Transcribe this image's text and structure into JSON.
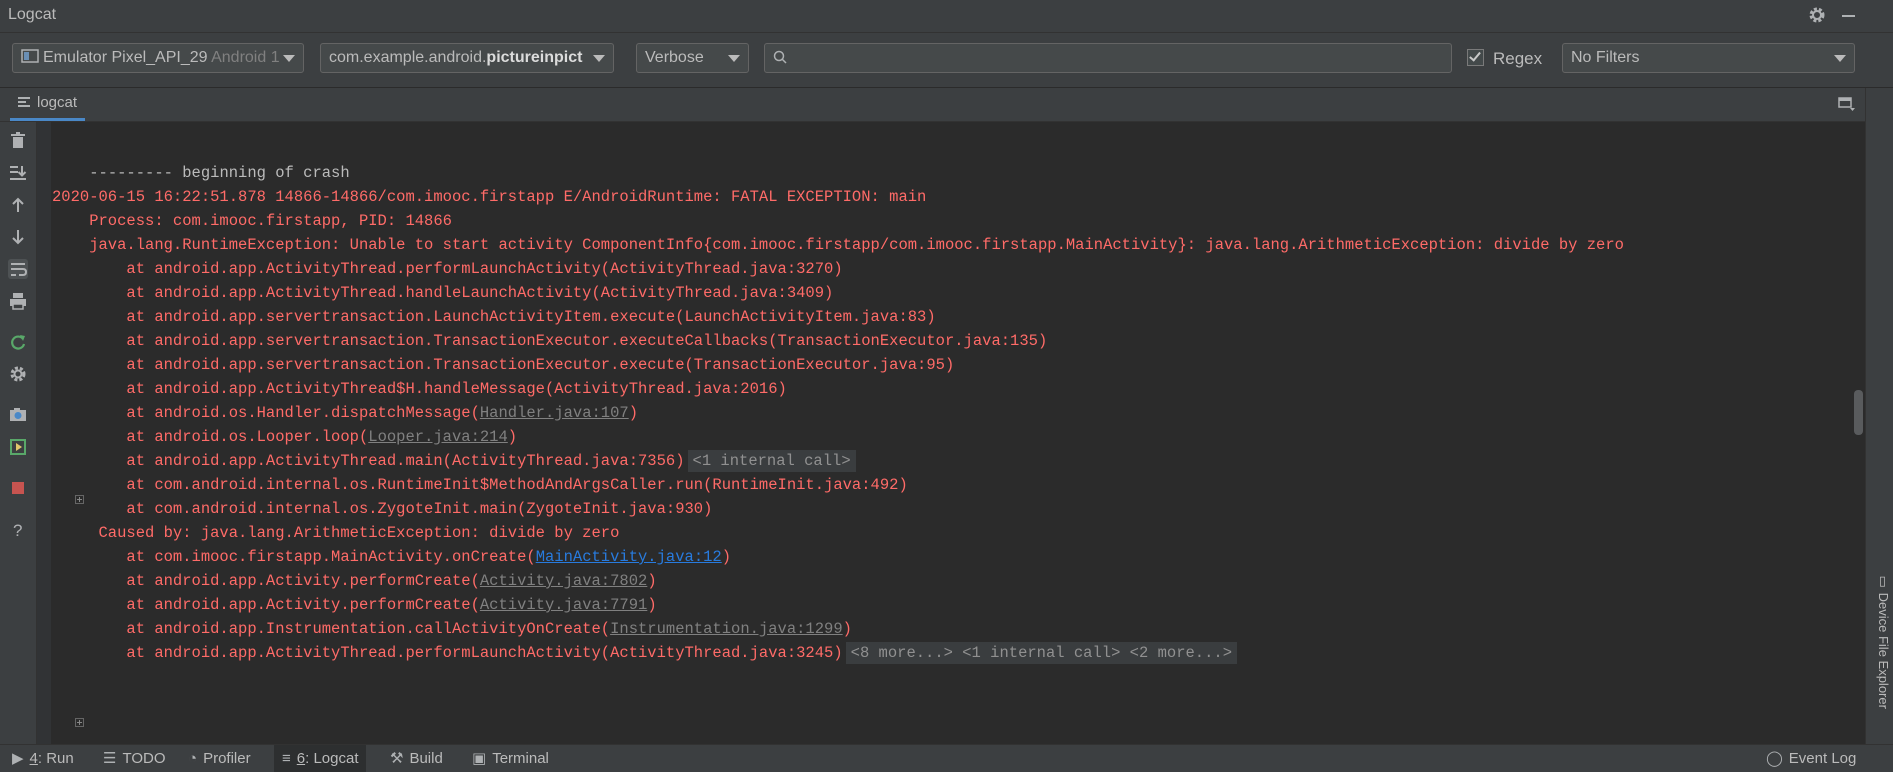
{
  "window": {
    "title": "Logcat"
  },
  "toolbar": {
    "device": {
      "name": "Emulator Pixel_API_29",
      "suffix": "Android 1"
    },
    "process": {
      "prefix": "com.example.android.",
      "bold": "pictureinpict"
    },
    "level": "Verbose",
    "search": {
      "value": "",
      "placeholder": ""
    },
    "regex": {
      "label": "Regex",
      "checked": true
    },
    "filter": "No Filters"
  },
  "tab": {
    "label": "logcat"
  },
  "log": {
    "l0": "--------- beginning of crash",
    "l1": "2020-06-15 16:22:51.878 14866-14866/com.imooc.firstapp E/AndroidRuntime: FATAL EXCEPTION: main",
    "l2": "    Process: com.imooc.firstapp, PID: 14866",
    "l3": "    java.lang.RuntimeException: Unable to start activity ComponentInfo{com.imooc.firstapp/com.imooc.firstapp.MainActivity}: java.lang.ArithmeticException: divide by zero",
    "l4": "        at android.app.ActivityThread.performLaunchActivity(ActivityThread.java:3270)",
    "l5": "        at android.app.ActivityThread.handleLaunchActivity(ActivityThread.java:3409)",
    "l6": "        at android.app.servertransaction.LaunchActivityItem.execute(LaunchActivityItem.java:83)",
    "l7": "        at android.app.servertransaction.TransactionExecutor.executeCallbacks(TransactionExecutor.java:135)",
    "l8": "        at android.app.servertransaction.TransactionExecutor.execute(TransactionExecutor.java:95)",
    "l9": "        at android.app.ActivityThread$H.handleMessage(ActivityThread.java:2016)",
    "l10": {
      "pre": "        at android.os.Handler.dispatchMessage(",
      "link": "Handler.java:107",
      "post": ")"
    },
    "l11": {
      "pre": "        at android.os.Looper.loop(",
      "link": "Looper.java:214",
      "post": ")"
    },
    "l12": {
      "pre": "        at android.app.ActivityThread.main(ActivityThread.java:7356)",
      "tag": "<1 internal call>"
    },
    "l13": "        at com.android.internal.os.RuntimeInit$MethodAndArgsCaller.run(RuntimeInit.java:492)",
    "l14": "        at com.android.internal.os.ZygoteInit.main(ZygoteInit.java:930)",
    "l15": "     Caused by: java.lang.ArithmeticException: divide by zero",
    "l16": {
      "pre": "        at com.imooc.firstapp.MainActivity.onCreate(",
      "link": "MainActivity.java:12",
      "post": ")"
    },
    "l17": {
      "pre": "        at android.app.Activity.performCreate(",
      "link": "Activity.java:7802",
      "post": ")"
    },
    "l18": {
      "pre": "        at android.app.Activity.performCreate(",
      "link": "Activity.java:7791",
      "post": ")"
    },
    "l19": {
      "pre": "        at android.app.Instrumentation.callActivityOnCreate(",
      "link": "Instrumentation.java:1299",
      "post": ")"
    },
    "l20": {
      "pre": "        at android.app.ActivityThread.performLaunchActivity(ActivityThread.java:3245)",
      "tag": "<8 more...> <1 internal call> <2 more...>"
    }
  },
  "right_panel": {
    "label": "Device File Explorer"
  },
  "statusbar": {
    "run": {
      "num": "4",
      "label": ": Run"
    },
    "todo": "TODO",
    "profiler": "Profiler",
    "logcat": {
      "num": "6",
      "label": ": Logcat"
    },
    "build": "Build",
    "terminal": "Terminal",
    "event_log": "Event Log"
  },
  "colors": {
    "error": "#ff6b68",
    "link": "#287bde",
    "background": "#2b2b2b",
    "panel": "#3c3f41"
  }
}
